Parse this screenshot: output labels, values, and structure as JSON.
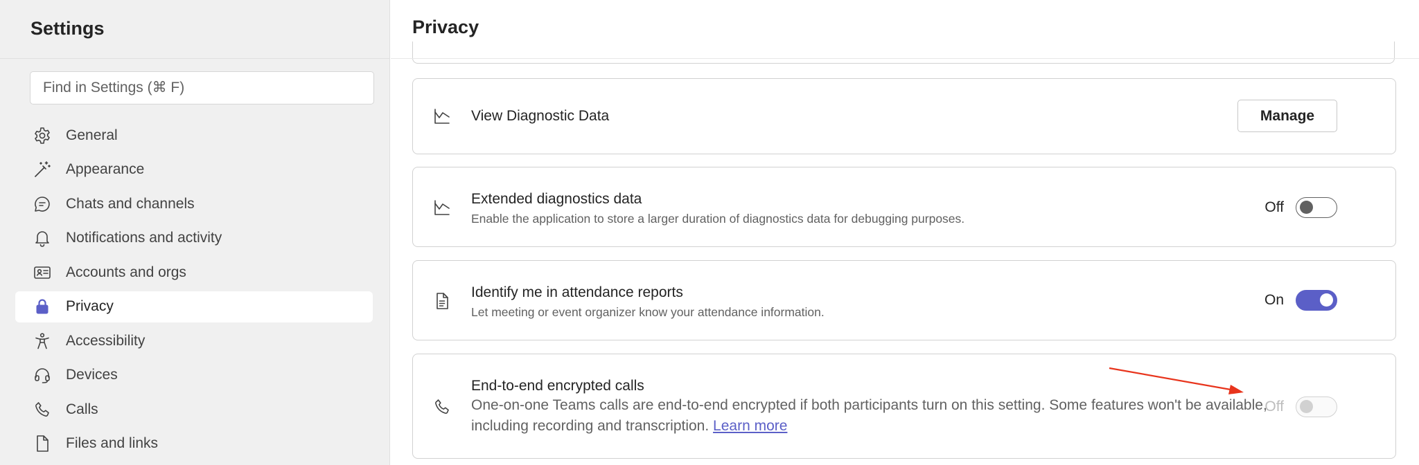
{
  "sidebar": {
    "title": "Settings",
    "search": {
      "placeholder": "Find in Settings (⌘ F)",
      "value": ""
    },
    "items": [
      {
        "label": "General",
        "icon": "gear-icon",
        "active": false
      },
      {
        "label": "Appearance",
        "icon": "magic-wand-icon",
        "active": false
      },
      {
        "label": "Chats and channels",
        "icon": "chat-bubble-icon",
        "active": false
      },
      {
        "label": "Notifications and activity",
        "icon": "bell-icon",
        "active": false
      },
      {
        "label": "Accounts and orgs",
        "icon": "id-card-icon",
        "active": false
      },
      {
        "label": "Privacy",
        "icon": "lock-icon",
        "active": true
      },
      {
        "label": "Accessibility",
        "icon": "accessibility-icon",
        "active": false
      },
      {
        "label": "Devices",
        "icon": "headset-icon",
        "active": false
      },
      {
        "label": "Calls",
        "icon": "phone-icon",
        "active": false
      },
      {
        "label": "Files and links",
        "icon": "document-icon",
        "active": false
      }
    ]
  },
  "main": {
    "title": "Privacy",
    "cards": {
      "diagnostic": {
        "icon": "chart-icon",
        "title": "View Diagnostic Data",
        "button_label": "Manage"
      },
      "extended": {
        "icon": "chart-icon",
        "title": "Extended diagnostics data",
        "description": "Enable the application to store a larger duration of diagnostics data for debugging purposes.",
        "toggle_label": "Off",
        "toggle_on": false
      },
      "attendance": {
        "icon": "document-icon",
        "title": "Identify me in attendance reports",
        "description": "Let meeting or event organizer know your attendance information.",
        "toggle_label": "On",
        "toggle_on": true
      },
      "encrypted": {
        "icon": "phone-icon",
        "title": "End-to-end encrypted calls",
        "description": "One-on-one Teams calls are end-to-end encrypted if both participants turn on this setting. Some features won't be available, including recording and transcription.",
        "link_label": "Learn more",
        "toggle_label": "Off",
        "toggle_on": false,
        "toggle_disabled": true
      }
    }
  },
  "colors": {
    "accent": "#5b5fc7",
    "annotation_arrow": "#e8341c",
    "sidebar_bg": "#f0f0f0"
  }
}
